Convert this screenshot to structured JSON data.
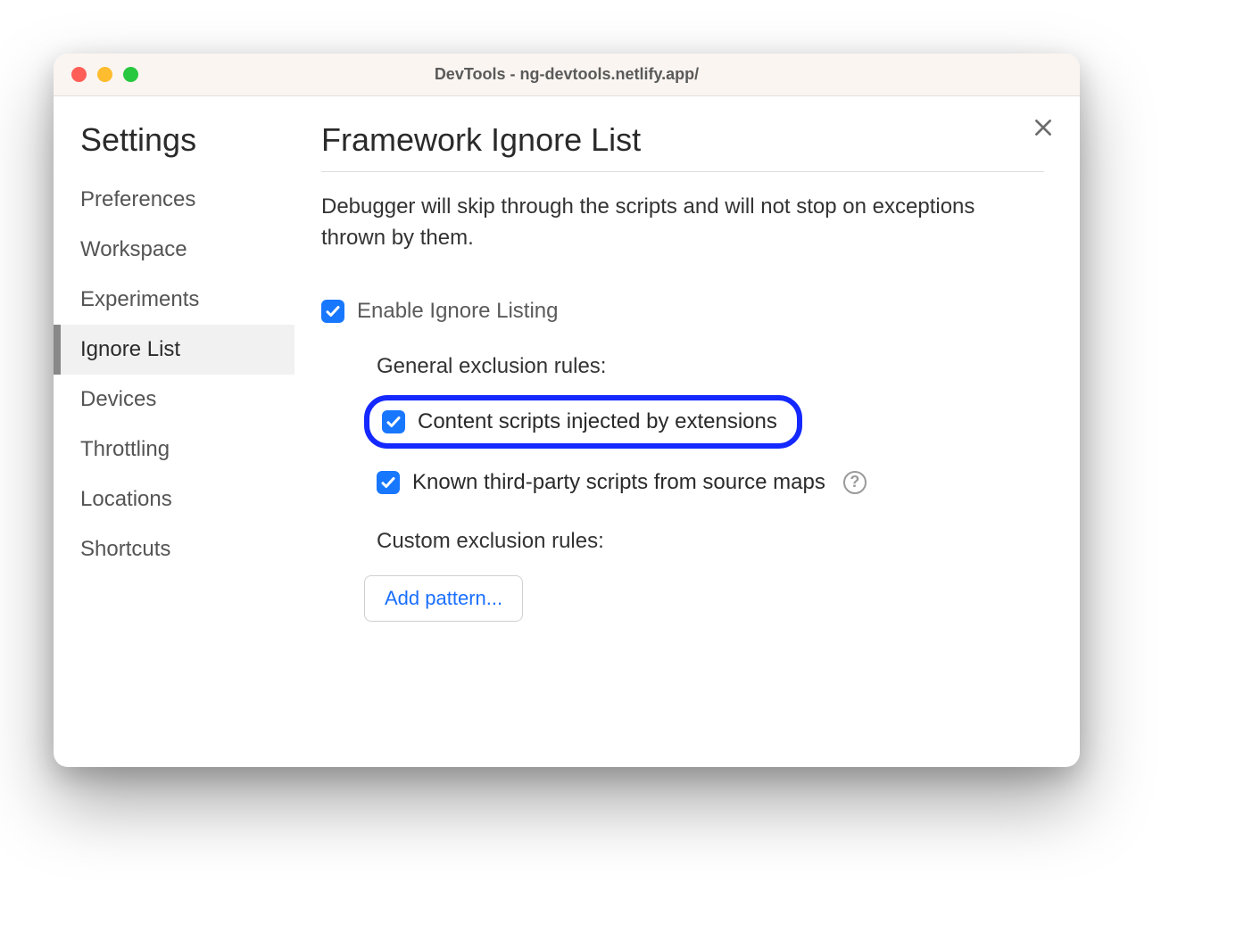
{
  "titlebar": {
    "title": "DevTools - ng-devtools.netlify.app/"
  },
  "sidebar": {
    "title": "Settings",
    "items": [
      {
        "label": "Preferences",
        "active": false
      },
      {
        "label": "Workspace",
        "active": false
      },
      {
        "label": "Experiments",
        "active": false
      },
      {
        "label": "Ignore List",
        "active": true
      },
      {
        "label": "Devices",
        "active": false
      },
      {
        "label": "Throttling",
        "active": false
      },
      {
        "label": "Locations",
        "active": false
      },
      {
        "label": "Shortcuts",
        "active": false
      }
    ]
  },
  "main": {
    "heading": "Framework Ignore List",
    "description": "Debugger will skip through the scripts and will not stop on exceptions thrown by them.",
    "enable_label": "Enable Ignore Listing",
    "general_rules_label": "General exclusion rules:",
    "rule_content_scripts": "Content scripts injected by extensions",
    "rule_third_party": "Known third-party scripts from source maps",
    "custom_rules_label": "Custom exclusion rules:",
    "add_pattern_label": "Add pattern..."
  }
}
